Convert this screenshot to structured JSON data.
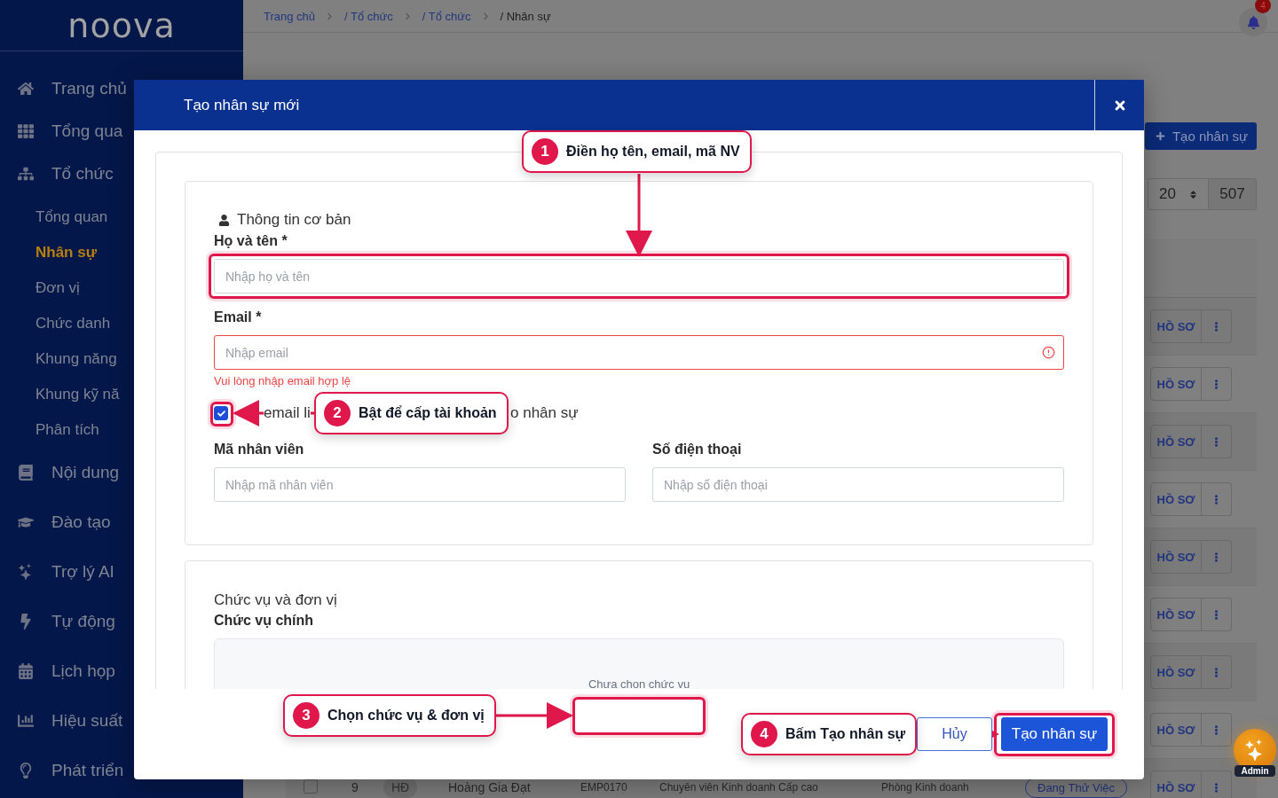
{
  "sidebar": {
    "logo": "noova",
    "items": [
      {
        "label": "Trang chủ",
        "selected": false
      },
      {
        "label": "Tổng qua",
        "selected": false
      },
      {
        "label": "Tổ chức",
        "selected": false,
        "children": [
          {
            "label": "Tổng quan",
            "selected": false
          },
          {
            "label": "Nhân sự",
            "selected": true
          },
          {
            "label": "Đơn vị",
            "selected": false
          },
          {
            "label": "Chức danh",
            "selected": false
          },
          {
            "label": "Khung năng",
            "selected": false
          },
          {
            "label": "Khung kỹ nă",
            "selected": false
          },
          {
            "label": "Phân tích",
            "selected": false
          }
        ]
      },
      {
        "label": "Nội dung",
        "selected": false
      },
      {
        "label": "Đào tạo",
        "selected": false
      },
      {
        "label": "Trợ lý AI",
        "selected": false
      },
      {
        "label": "Tự động",
        "selected": false
      },
      {
        "label": "Lịch họp",
        "selected": false
      },
      {
        "label": "Hiệu suất",
        "selected": false
      },
      {
        "label": "Phát triển",
        "selected": false
      }
    ]
  },
  "topbar": {
    "breadcrumb": [
      {
        "label": "Trang chủ",
        "current": false
      },
      {
        "label": "/ Tổ chức",
        "current": false
      },
      {
        "label": "/ Tổ chức",
        "current": false
      },
      {
        "label": "/ Nhân sự",
        "current": true
      }
    ],
    "notifications": "4"
  },
  "page": {
    "create_button": "Tạo nhân sự",
    "page_size": "20",
    "total": "507"
  },
  "table": {
    "rows": [
      {
        "action": "HỒ SƠ"
      },
      {
        "action": "HỒ SƠ"
      },
      {
        "action": "HỒ SƠ"
      },
      {
        "action": "HỒ SƠ"
      },
      {
        "action": "HỒ SƠ"
      },
      {
        "action": "HỒ SƠ"
      },
      {
        "action": "HỒ SƠ"
      },
      {
        "action": "HỒ SƠ"
      },
      {
        "checked": false,
        "index": "9",
        "initials": "HĐ",
        "name": "Hoàng Gia Đạt",
        "code": "EMP0170",
        "position": "Chuyên viên Kinh doanh Cấp cao",
        "department": "Phòng Kinh doanh",
        "status": "Đang Thử Việc",
        "action": "HỒ SƠ"
      }
    ]
  },
  "assistant": {
    "label": "Admin"
  },
  "modal": {
    "title": "Tạo nhân sự mới",
    "basic": {
      "heading": "Thông tin cơ bản",
      "name": {
        "label": "Họ và tên *",
        "placeholder": "Nhập họ và tên"
      },
      "email": {
        "label": "Email *",
        "placeholder": "Nhập email",
        "error": "Vui lòng nhập email hợp lệ"
      },
      "account": {
        "checked": true,
        "label_parts": [
          "email li",
          "o nhân sự"
        ]
      },
      "code": {
        "label": "Mã nhân viên",
        "placeholder": "Nhập mã nhân viên"
      },
      "phone": {
        "label": "Số điện thoại",
        "placeholder": "Nhập số điện thoại"
      }
    },
    "assignment": {
      "heading": "Chức vụ và đơn vị",
      "primary_label": "Chức vụ chính",
      "empty_text": "Chưa chọn chức vụ"
    },
    "buttons": [
      {
        "label": "Hủy",
        "kind": "secondary"
      },
      {
        "label": "Tạo nhân sự",
        "kind": "primary"
      }
    ]
  },
  "annotations": [
    {
      "number": "1",
      "text": "Điền họ tên, email, mã NV"
    },
    {
      "number": "2",
      "text": "Bật để cấp tài khoản"
    },
    {
      "number": "3",
      "text": "Chọn chức vụ & đơn vị"
    },
    {
      "number": "4",
      "text": "Bấm Tạo nhân sự"
    }
  ]
}
